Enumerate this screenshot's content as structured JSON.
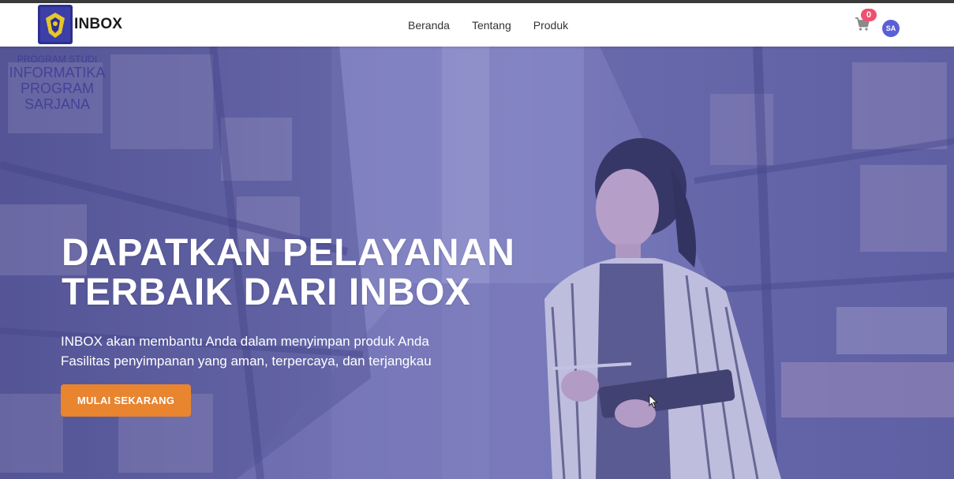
{
  "navbar": {
    "brand": "INBOX",
    "links": [
      "Beranda",
      "Tentang",
      "Produk"
    ],
    "cart_count": "0",
    "avatar_initials": "SA"
  },
  "watermark": {
    "line1": "PROGRAM STUDI",
    "line2": "INFORMATIKA",
    "line3": "PROGRAM SARJANA"
  },
  "hero": {
    "headline_line1": "DAPATKAN PELAYANAN",
    "headline_line2": "TERBAIK DARI INBOX",
    "sub_line1": "INBOX akan membantu Anda dalam menyimpan produk Anda",
    "sub_line2": "Fasilitas penyimpanan yang aman, terpercaya, dan terjangkau",
    "cta_label": "MULAI SEKARANG"
  },
  "colors": {
    "cta": "#e9842f",
    "badge": "#f0506e",
    "avatar": "#5b5fd6",
    "hero_tint": "#6a6ab8"
  }
}
